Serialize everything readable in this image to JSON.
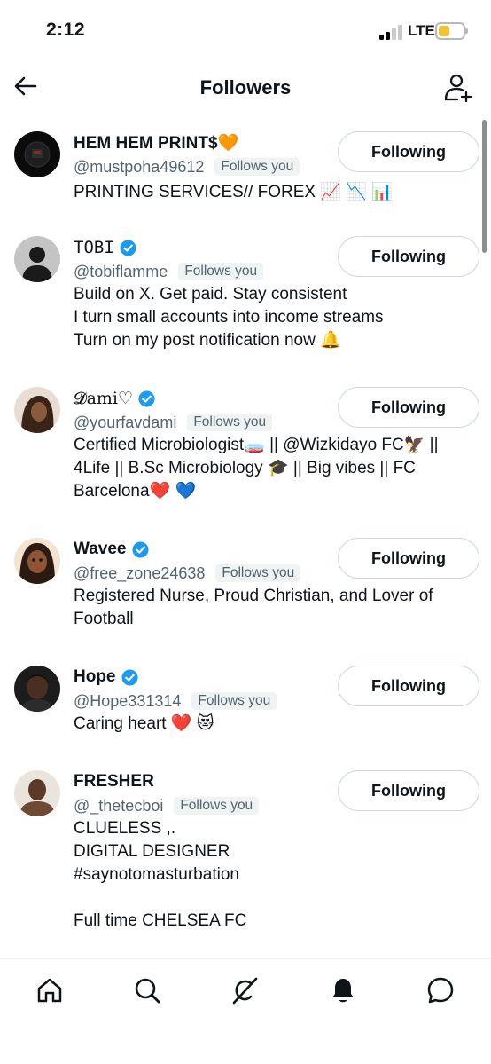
{
  "status": {
    "time": "2:12",
    "network": "LTE",
    "battery_level": 0.45,
    "battery_color": "#f4c430"
  },
  "header": {
    "title": "Followers",
    "back_icon": "arrow-left-icon",
    "add_icon": "add-user-icon"
  },
  "followers": [
    {
      "name": "HEM HEM PRINT$🧡",
      "verified": false,
      "handle": "@mustpoha49612",
      "follows_you": "Follows you",
      "bio": "PRINTING SERVICES// FOREX 📈 📉 📊",
      "button": "Following"
    },
    {
      "name": "TOBI",
      "verified": true,
      "handle": "@tobiflamme",
      "follows_you": "Follows you",
      "bio": "Build on X. Get paid. Stay consistent\nI turn small accounts into income streams\nTurn on my post notification now 🔔",
      "button": "Following"
    },
    {
      "name": "𝓓ami♡",
      "verified": true,
      "handle": "@yourfavdami",
      "follows_you": "Follows you",
      "bio": "Certified Microbiologist🧫 || @Wizkidayo FC🦅 ||\n4Life || B.Sc Microbiology 🎓 || Big vibes || FC\nBarcelona❤️ 💙",
      "button": "Following"
    },
    {
      "name": "Wavee",
      "verified": true,
      "handle": "@free_zone24638",
      "follows_you": "Follows you",
      "bio": "Registered Nurse, Proud Christian, and Lover of\nFootball",
      "button": "Following"
    },
    {
      "name": "Hope",
      "verified": true,
      "handle": "@Hope331314",
      "follows_you": "Follows you",
      "bio": "Caring heart ❤️ 😻",
      "button": "Following"
    },
    {
      "name": "FRESHER",
      "verified": false,
      "handle": "@_thetecboi",
      "follows_you": "Follows you",
      "bio": "CLUELESS ,.\nDIGITAL DESIGNER\n#saynotomasturbation\n\nFull time CHELSEA FC",
      "button": "Following"
    }
  ],
  "nav": [
    "home-icon",
    "search-icon",
    "grok-icon",
    "notifications-icon",
    "messages-icon"
  ],
  "colors": {
    "verified": "#1d9bf0",
    "text": "#0f1419",
    "secondary": "#536471"
  }
}
